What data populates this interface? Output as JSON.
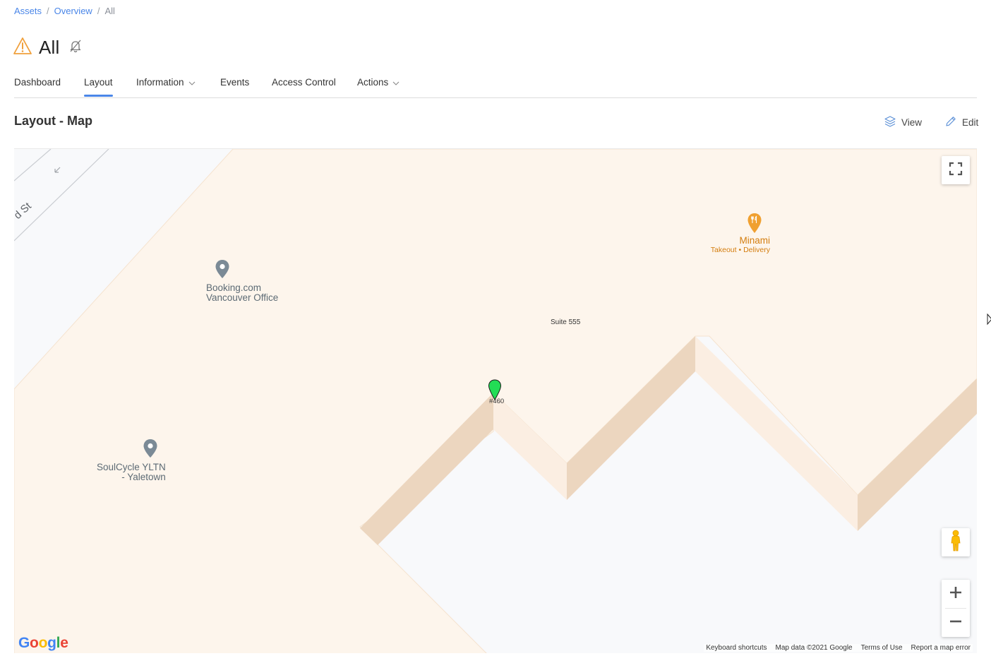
{
  "breadcrumb": {
    "items": [
      {
        "label": "Assets"
      },
      {
        "label": "Overview"
      }
    ],
    "separator": "/",
    "current": "All"
  },
  "page": {
    "title": "All",
    "alert_icon": "warning-triangle-icon",
    "mute_icon": "bell-off-icon",
    "accent_color": "#f0a03c"
  },
  "tabs": [
    {
      "label": "Dashboard",
      "active": false
    },
    {
      "label": "Layout",
      "active": true
    },
    {
      "label": "Information",
      "active": false,
      "dropdown": true
    },
    {
      "label": "Events",
      "active": false
    },
    {
      "label": "Access Control",
      "active": false
    },
    {
      "label": "Actions",
      "active": false,
      "dropdown": true
    }
  ],
  "section": {
    "title": "Layout - Map",
    "view_label": "View",
    "edit_label": "Edit"
  },
  "map": {
    "street_label": "d St",
    "pois": [
      {
        "name_line1": "Booking.com",
        "name_line2": "Vancouver Office",
        "icon": "place-pin-icon"
      },
      {
        "name_line1": "SoulCycle YLTN",
        "name_line2": "- Yaletown",
        "icon": "place-pin-icon"
      },
      {
        "name_line1": "Minami",
        "name_line2": "Takeout • Delivery",
        "icon": "restaurant-pin-icon"
      }
    ],
    "suite_label": "Suite 555",
    "marker_label": "#460",
    "marker_color": "#22dd55",
    "footer": {
      "keyboard": "Keyboard shortcuts",
      "map_data": "Map data ©2021 Google",
      "terms": "Terms of Use",
      "report": "Report a map error"
    },
    "logo_text": "Google"
  }
}
